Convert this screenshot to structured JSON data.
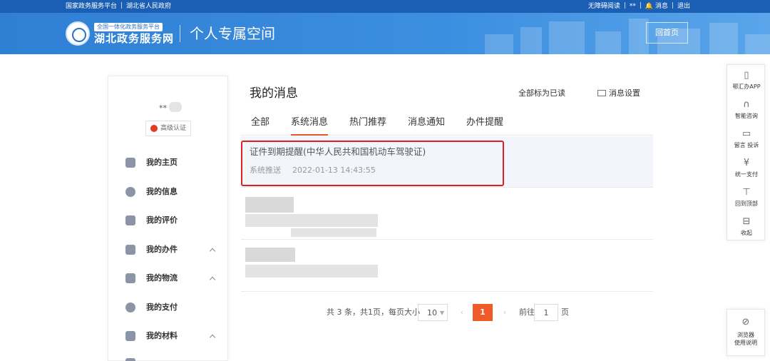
{
  "topbar": {
    "left_links": [
      "国家政务服务平台",
      "湖北省人民政府"
    ],
    "right_links": [
      "无障碍阅读",
      "**",
      "消息",
      "退出"
    ]
  },
  "header": {
    "logo_sub": "全国一体化政务服务平台",
    "logo_main": "湖北政务服务网",
    "title": "个人专属空间",
    "home_button": "回首页"
  },
  "sidebar": {
    "username": "**",
    "cert_label": "高级认证",
    "items": [
      {
        "label": "我的主页",
        "icon": "home-icon",
        "expandable": false
      },
      {
        "label": "我的信息",
        "icon": "chat-icon",
        "expandable": false
      },
      {
        "label": "我的评价",
        "icon": "edit-icon",
        "expandable": false
      },
      {
        "label": "我的办件",
        "icon": "document-icon",
        "expandable": true
      },
      {
        "label": "我的物流",
        "icon": "box-icon",
        "expandable": true
      },
      {
        "label": "我的支付",
        "icon": "yen-icon",
        "expandable": false
      },
      {
        "label": "我的材料",
        "icon": "folder-icon",
        "expandable": true
      }
    ]
  },
  "main": {
    "title": "我的消息",
    "mark_all_read": "全部标为已读",
    "settings": "消息设置",
    "tabs": [
      {
        "label": "全部",
        "active": false
      },
      {
        "label": "系统消息",
        "active": true
      },
      {
        "label": "热门推荐",
        "active": false
      },
      {
        "label": "消息通知",
        "active": false
      },
      {
        "label": "办件提醒",
        "active": false
      }
    ],
    "messages": [
      {
        "title": "证件到期提醒(中华人民共和国机动车驾驶证)",
        "source": "系统推送",
        "time": "2022-01-13 14:43:55"
      }
    ]
  },
  "pagination": {
    "summary": "共 3 条，共1页，每页大小",
    "page_size": "10",
    "current_page": "1",
    "goto_label": "前往",
    "goto_value": "1",
    "page_unit": "页"
  },
  "float_bar": {
    "items": [
      {
        "label": "鄂汇办APP",
        "icon": "phone-icon"
      },
      {
        "label": "智能咨询",
        "icon": "headset-icon"
      },
      {
        "label": "留言 投诉",
        "icon": "comment-icon"
      },
      {
        "label": "统一支付",
        "icon": "yen-icon"
      },
      {
        "label": "回到顶部",
        "icon": "arrow-up-icon"
      },
      {
        "label": "收起",
        "icon": "collapse-icon"
      }
    ],
    "help_label": [
      "浏览器",
      "使用说明"
    ]
  }
}
